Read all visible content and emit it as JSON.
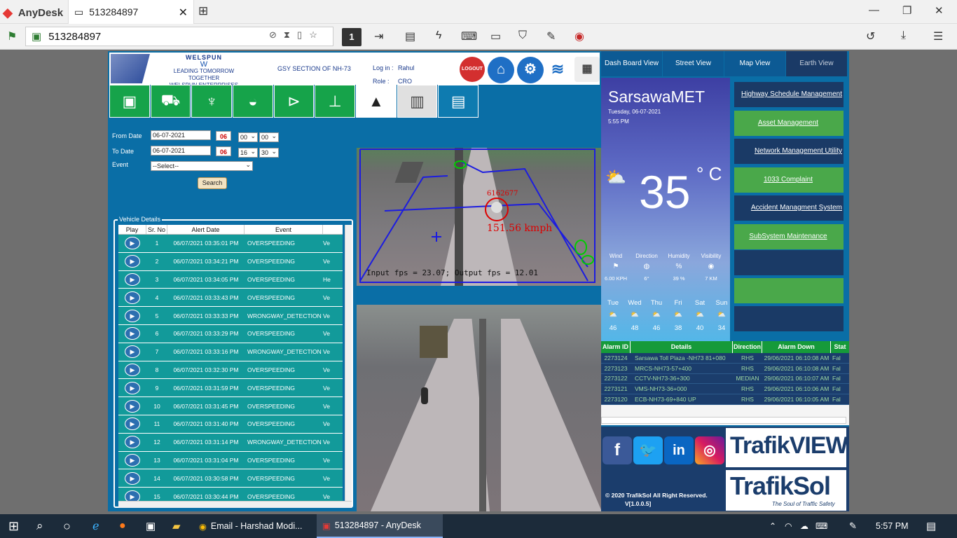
{
  "titlebar": {
    "app_name": "AnyDesk",
    "tab_title": "513284897"
  },
  "addressbar": {
    "address": "513284897",
    "monitor_num": "1"
  },
  "header": {
    "brand_name": "WELSPUN",
    "tagline": "LEADING TOMORROW TOGETHER",
    "company": "WELSPUN ENTERPRISES LTD",
    "section": "GSY SECTION OF NH-73",
    "login_label": "Log in :",
    "login_value": "Rahul",
    "role_label": "Role   :",
    "role_value": "CRO",
    "logout": "LOGOUT"
  },
  "form": {
    "from_label": "From Date",
    "from_date": "06-07-2021",
    "from_cal": "06",
    "from_h": "00",
    "from_m": "00",
    "to_label": "To Date",
    "to_date": "06-07-2021",
    "to_cal": "06",
    "to_h": "16",
    "to_m": "30",
    "event_label": "Event",
    "event_value": "--Select--",
    "search": "Search"
  },
  "vehicle": {
    "legend": "Vehicle Details",
    "cols": [
      "Play",
      "Sr. No",
      "Alert Date",
      "Event"
    ],
    "rows": [
      {
        "sr": "1",
        "date": "06/07/2021 03:35:01 PM",
        "event": "OVERSPEEDING",
        "extra": "Ve"
      },
      {
        "sr": "2",
        "date": "06/07/2021 03:34:21 PM",
        "event": "OVERSPEEDING",
        "extra": "Ve"
      },
      {
        "sr": "3",
        "date": "06/07/2021 03:34:05 PM",
        "event": "OVERSPEEDING",
        "extra": "He"
      },
      {
        "sr": "4",
        "date": "06/07/2021 03:33:43 PM",
        "event": "OVERSPEEDING",
        "extra": "Ve"
      },
      {
        "sr": "5",
        "date": "06/07/2021 03:33:33 PM",
        "event": "WRONGWAY_DETECTION",
        "extra": "Ve"
      },
      {
        "sr": "6",
        "date": "06/07/2021 03:33:29 PM",
        "event": "OVERSPEEDING",
        "extra": "Ve"
      },
      {
        "sr": "7",
        "date": "06/07/2021 03:33:16 PM",
        "event": "WRONGWAY_DETECTION",
        "extra": "Ve"
      },
      {
        "sr": "8",
        "date": "06/07/2021 03:32:30 PM",
        "event": "OVERSPEEDING",
        "extra": "Ve"
      },
      {
        "sr": "9",
        "date": "06/07/2021 03:31:59 PM",
        "event": "OVERSPEEDING",
        "extra": "Ve"
      },
      {
        "sr": "10",
        "date": "06/07/2021 03:31:45 PM",
        "event": "OVERSPEEDING",
        "extra": "Ve"
      },
      {
        "sr": "11",
        "date": "06/07/2021 03:31:40 PM",
        "event": "OVERSPEEDING",
        "extra": "Ve"
      },
      {
        "sr": "12",
        "date": "06/07/2021 03:31:14 PM",
        "event": "WRONGWAY_DETECTION",
        "extra": "Ve"
      },
      {
        "sr": "13",
        "date": "06/07/2021 03:31:04 PM",
        "event": "OVERSPEEDING",
        "extra": "Ve"
      },
      {
        "sr": "14",
        "date": "06/07/2021 03:30:58 PM",
        "event": "OVERSPEEDING",
        "extra": "Ve"
      },
      {
        "sr": "15",
        "date": "06/07/2021 03:30:44 PM",
        "event": "OVERSPEEDING",
        "extra": "Ve"
      }
    ]
  },
  "camera": {
    "speed_id": "6162677",
    "speed": "151.56 kmph",
    "fps": "Input fps = 23.07; Output fps = 12.01"
  },
  "tabs": [
    "Dash Board View",
    "Street View",
    "Map View",
    "Earth View"
  ],
  "weather": {
    "station": "SarsawaMET",
    "date": "Tuesday, 06-07-2021",
    "time": "5:55 PM",
    "temp": "35",
    "unit": "° C",
    "metrics": [
      {
        "label": "Wind",
        "value": "6.00 KPH"
      },
      {
        "label": "Direction",
        "value": "6°"
      },
      {
        "label": "Humidity",
        "value": "39 %"
      },
      {
        "label": "Visibility",
        "value": "7 KM"
      }
    ],
    "forecast": [
      {
        "d": "Tue",
        "t": "46"
      },
      {
        "d": "Wed",
        "t": "48"
      },
      {
        "d": "Thu",
        "t": "46"
      },
      {
        "d": "Fri",
        "t": "38"
      },
      {
        "d": "Sat",
        "t": "40"
      },
      {
        "d": "Sun",
        "t": "34"
      }
    ]
  },
  "menu": [
    "Highway Schedule Management",
    "Asset Management",
    "Network Management Utility",
    "1033 Complaint",
    "Accident Managment System",
    "SubSystem Maintenance"
  ],
  "alarm": {
    "cols": [
      "Alarm ID",
      "Details",
      "Direction",
      "Alarm Down",
      "Stat"
    ],
    "rows": [
      {
        "id": "2273124",
        "details": "Sarsawa Toll Plaza -NH73 81+080",
        "dir": "RHS",
        "down": "29/06/2021 06:10:08 AM",
        "stat": "Fal"
      },
      {
        "id": "2273123",
        "details": "MRCS-NH73-57+400",
        "dir": "RHS",
        "down": "29/06/2021 06:10:08 AM",
        "stat": "Fal"
      },
      {
        "id": "2273122",
        "details": "CCTV-NH73-36+300",
        "dir": "MEDIAN",
        "down": "29/06/2021 06:10:07 AM",
        "stat": "Fal"
      },
      {
        "id": "2273121",
        "details": "VMS-NH73-36+000",
        "dir": "RHS",
        "down": "29/06/2021 06:10:06 AM",
        "stat": "Fal"
      },
      {
        "id": "2273120",
        "details": "ECB-NH73-69+840 UP",
        "dir": "RHS",
        "down": "29/06/2021 06:10:05 AM",
        "stat": "Fal"
      }
    ]
  },
  "footer": {
    "copyright": "© 2020 TrafikSol All Right Reserved.",
    "version": "V[1.0.0.5]",
    "trafik_view": "TrafikVIEW",
    "trafiksol": "TrafikSol",
    "slogan": "The Soul of Traffic Safety"
  },
  "taskbar": {
    "chrome_item": "Email - Harshad Modi...",
    "anydesk_item": "513284897 - AnyDesk",
    "time": "5:57 PM"
  },
  "colors": {
    "app_bg": "#0a6ea6",
    "green": "#16a34a",
    "row_teal": "#129a9a",
    "navy": "#1b3d6c"
  }
}
